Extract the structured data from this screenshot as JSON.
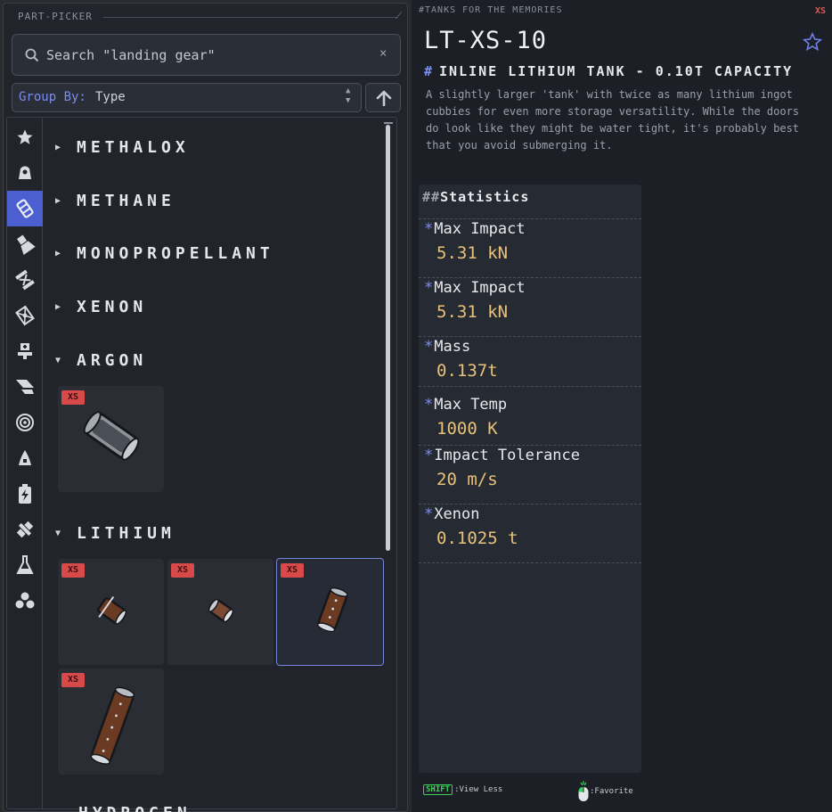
{
  "picker": {
    "title": "PART-PICKER",
    "search": {
      "placeholder": "Search \"landing gear\"",
      "clear": "×"
    },
    "group_by": {
      "label": "Group By:",
      "value": "Type"
    },
    "rail_icons": [
      "star-icon",
      "capsule-icon",
      "fuel-tank-icon",
      "engine-icon",
      "coupler-icon",
      "structural-icon",
      "docking-port-icon",
      "wing-icon",
      "wheel-icon",
      "nose-cone-icon",
      "battery-icon",
      "satellite-icon",
      "science-flask-icon",
      "resources-icon"
    ],
    "categories": [
      {
        "label": "METHALOX",
        "expanded": false
      },
      {
        "label": "METHANE",
        "expanded": false
      },
      {
        "label": "MONOPROPELLANT",
        "expanded": false
      },
      {
        "label": "XENON",
        "expanded": false
      },
      {
        "label": "ARGON",
        "expanded": true
      },
      {
        "label": "LITHIUM",
        "expanded": true
      }
    ],
    "size_badge": "XS",
    "next_category_peek": "HYDROGEN"
  },
  "detail": {
    "breadcrumb": "#TANKS FOR THE MEMORIES",
    "size_tag": "XS",
    "title": "LT-XS-10",
    "type_hash": "#",
    "type": "INLINE LITHIUM TANK - 0.10T CAPACITY",
    "description": "A slightly larger 'tank' with twice as many lithium ingot cubbies for even more storage versatility. While the doors do look like they might be water tight, it's probably best that you avoid submerging it.",
    "stats_hash": "##",
    "stats_title": "Statistics",
    "stat_marker": "*",
    "stats": [
      {
        "label": "Max Impact",
        "value": "5.31 kN"
      },
      {
        "label": "Max Impact",
        "value": "5.31 kN"
      },
      {
        "label": "Mass",
        "value": "0.137t"
      },
      {
        "label": "Max Temp",
        "value": "1000 K"
      },
      {
        "label": "Impact Tolerance",
        "value": "20 m/s"
      },
      {
        "label": "Xenon",
        "value": "0.1025 t"
      }
    ]
  },
  "hints": {
    "shift_key": "SHIFT",
    "shift_action": ":View Less",
    "mouse_action": ":Favorite"
  },
  "colors": {
    "accent": "#7b8df0",
    "active_rail": "#4c5fd0",
    "value": "#e8c27a",
    "badge": "#d84a4a",
    "shift": "#3bd05a"
  }
}
